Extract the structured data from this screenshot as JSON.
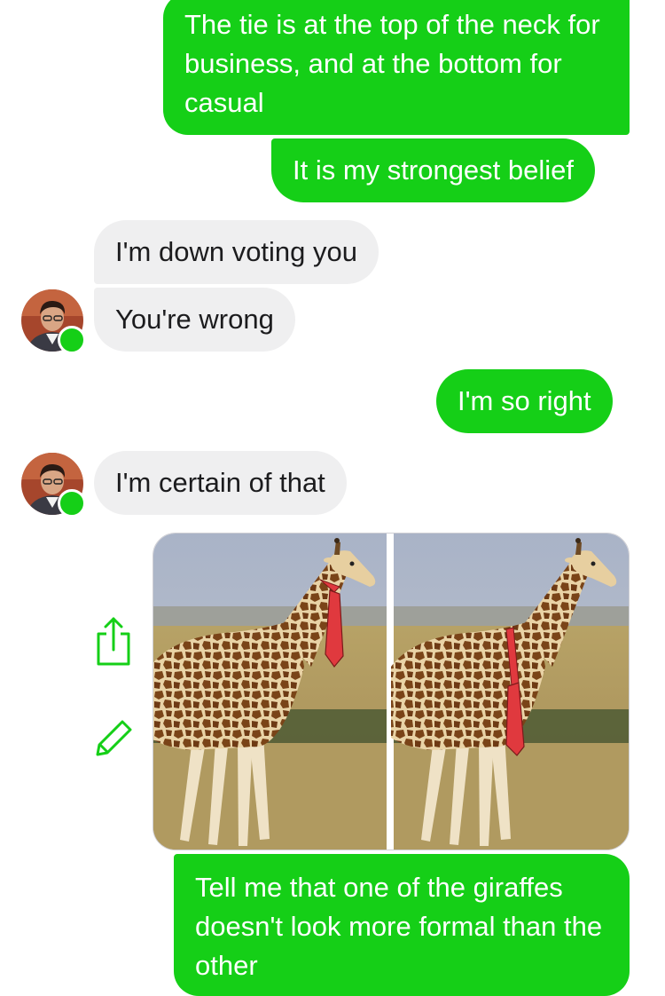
{
  "colors": {
    "outgoing_bubble": "#15cf17",
    "incoming_bubble": "#efeff0",
    "online_dot": "#15cf17",
    "tie": "#e0393e"
  },
  "messages": [
    {
      "direction": "outgoing",
      "text": "The tie is at the top of the neck for business, and at the bottom for casual"
    },
    {
      "direction": "outgoing",
      "text": "It is my strongest belief"
    },
    {
      "direction": "incoming",
      "text": "I'm down voting you"
    },
    {
      "direction": "incoming",
      "text": "You're wrong"
    },
    {
      "direction": "outgoing",
      "text": "I'm so right"
    },
    {
      "direction": "incoming",
      "text": "I'm certain of that"
    },
    {
      "direction": "outgoing",
      "type": "image",
      "content": "two giraffe photos side by side wearing red ties"
    },
    {
      "direction": "outgoing",
      "text": "Tell me that one of the giraffes doesn't look more formal than the other"
    }
  ],
  "icons": {
    "share": "share-icon",
    "edit": "pencil-icon",
    "avatar": "contact-avatar",
    "online": "online-status-dot"
  }
}
